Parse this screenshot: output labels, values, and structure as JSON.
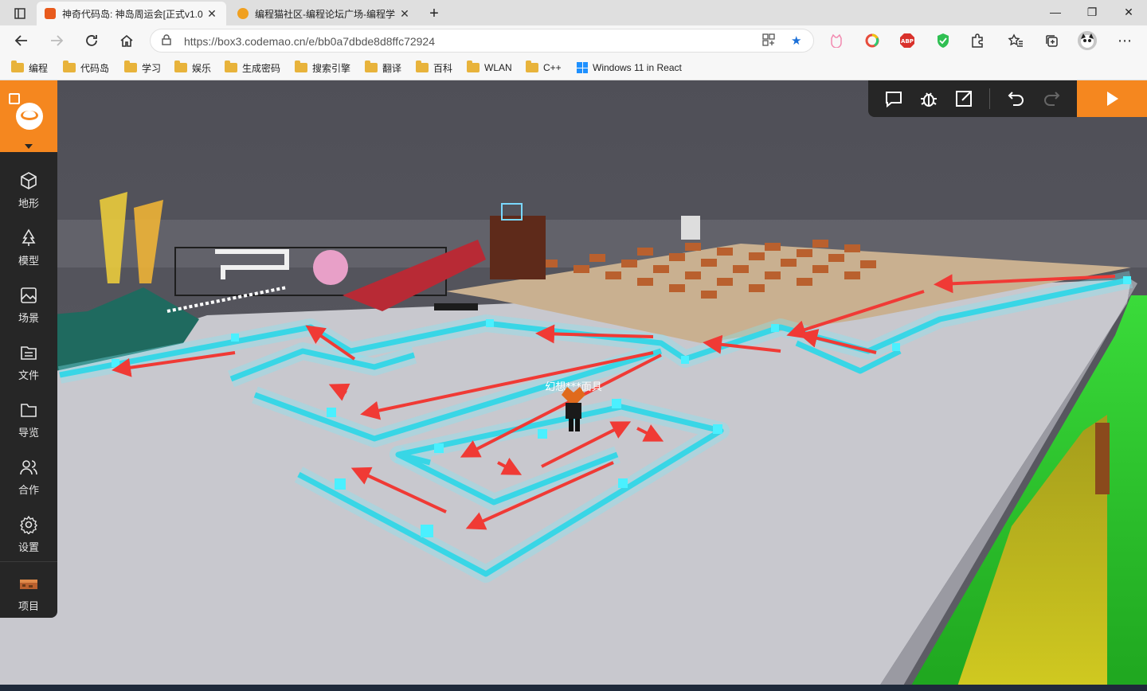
{
  "browser": {
    "tabs": [
      {
        "title": "神奇代码岛: 神岛周运会[正式v1.0",
        "favicon_color": "#e85a1c",
        "active": true
      },
      {
        "title": "编程猫社区-编程论坛广场-编程学",
        "favicon_color": "#f0a020",
        "active": false
      }
    ],
    "new_tab": "+",
    "window_controls": {
      "minimize": "—",
      "restore": "❐",
      "close": "✕"
    },
    "url": "https://box3.codemao.cn/e/bb0a7dbde8d8ffc72924",
    "bookmarks": [
      "编程",
      "代码岛",
      "学习",
      "娱乐",
      "生成密码",
      "搜索引擎",
      "翻译",
      "百科",
      "WLAN",
      "C++",
      "Windows 11 in React"
    ]
  },
  "sidebar": {
    "items": [
      {
        "label": "地形",
        "icon": "cube-icon"
      },
      {
        "label": "模型",
        "icon": "tree-icon"
      },
      {
        "label": "场景",
        "icon": "image-icon"
      },
      {
        "label": "文件",
        "icon": "file-icon"
      },
      {
        "label": "导览",
        "icon": "folder-icon"
      },
      {
        "label": "合作",
        "icon": "users-icon"
      },
      {
        "label": "设置",
        "icon": "gear-icon"
      },
      {
        "label": "项目",
        "icon": "project-thumbnail-icon"
      }
    ]
  },
  "toolbar": {
    "buttons": [
      "comment-icon",
      "debug-icon",
      "expand-icon",
      "undo-icon",
      "redo-icon",
      "play-icon"
    ]
  },
  "scene": {
    "player_name": "幻想***面具"
  },
  "colors": {
    "accent": "#f5871f",
    "sidebar_bg": "#262626",
    "neon": "#38e0f0",
    "arrow": "#f03a35",
    "ground": "#c9c9cf",
    "sky": "#5b5b63"
  }
}
